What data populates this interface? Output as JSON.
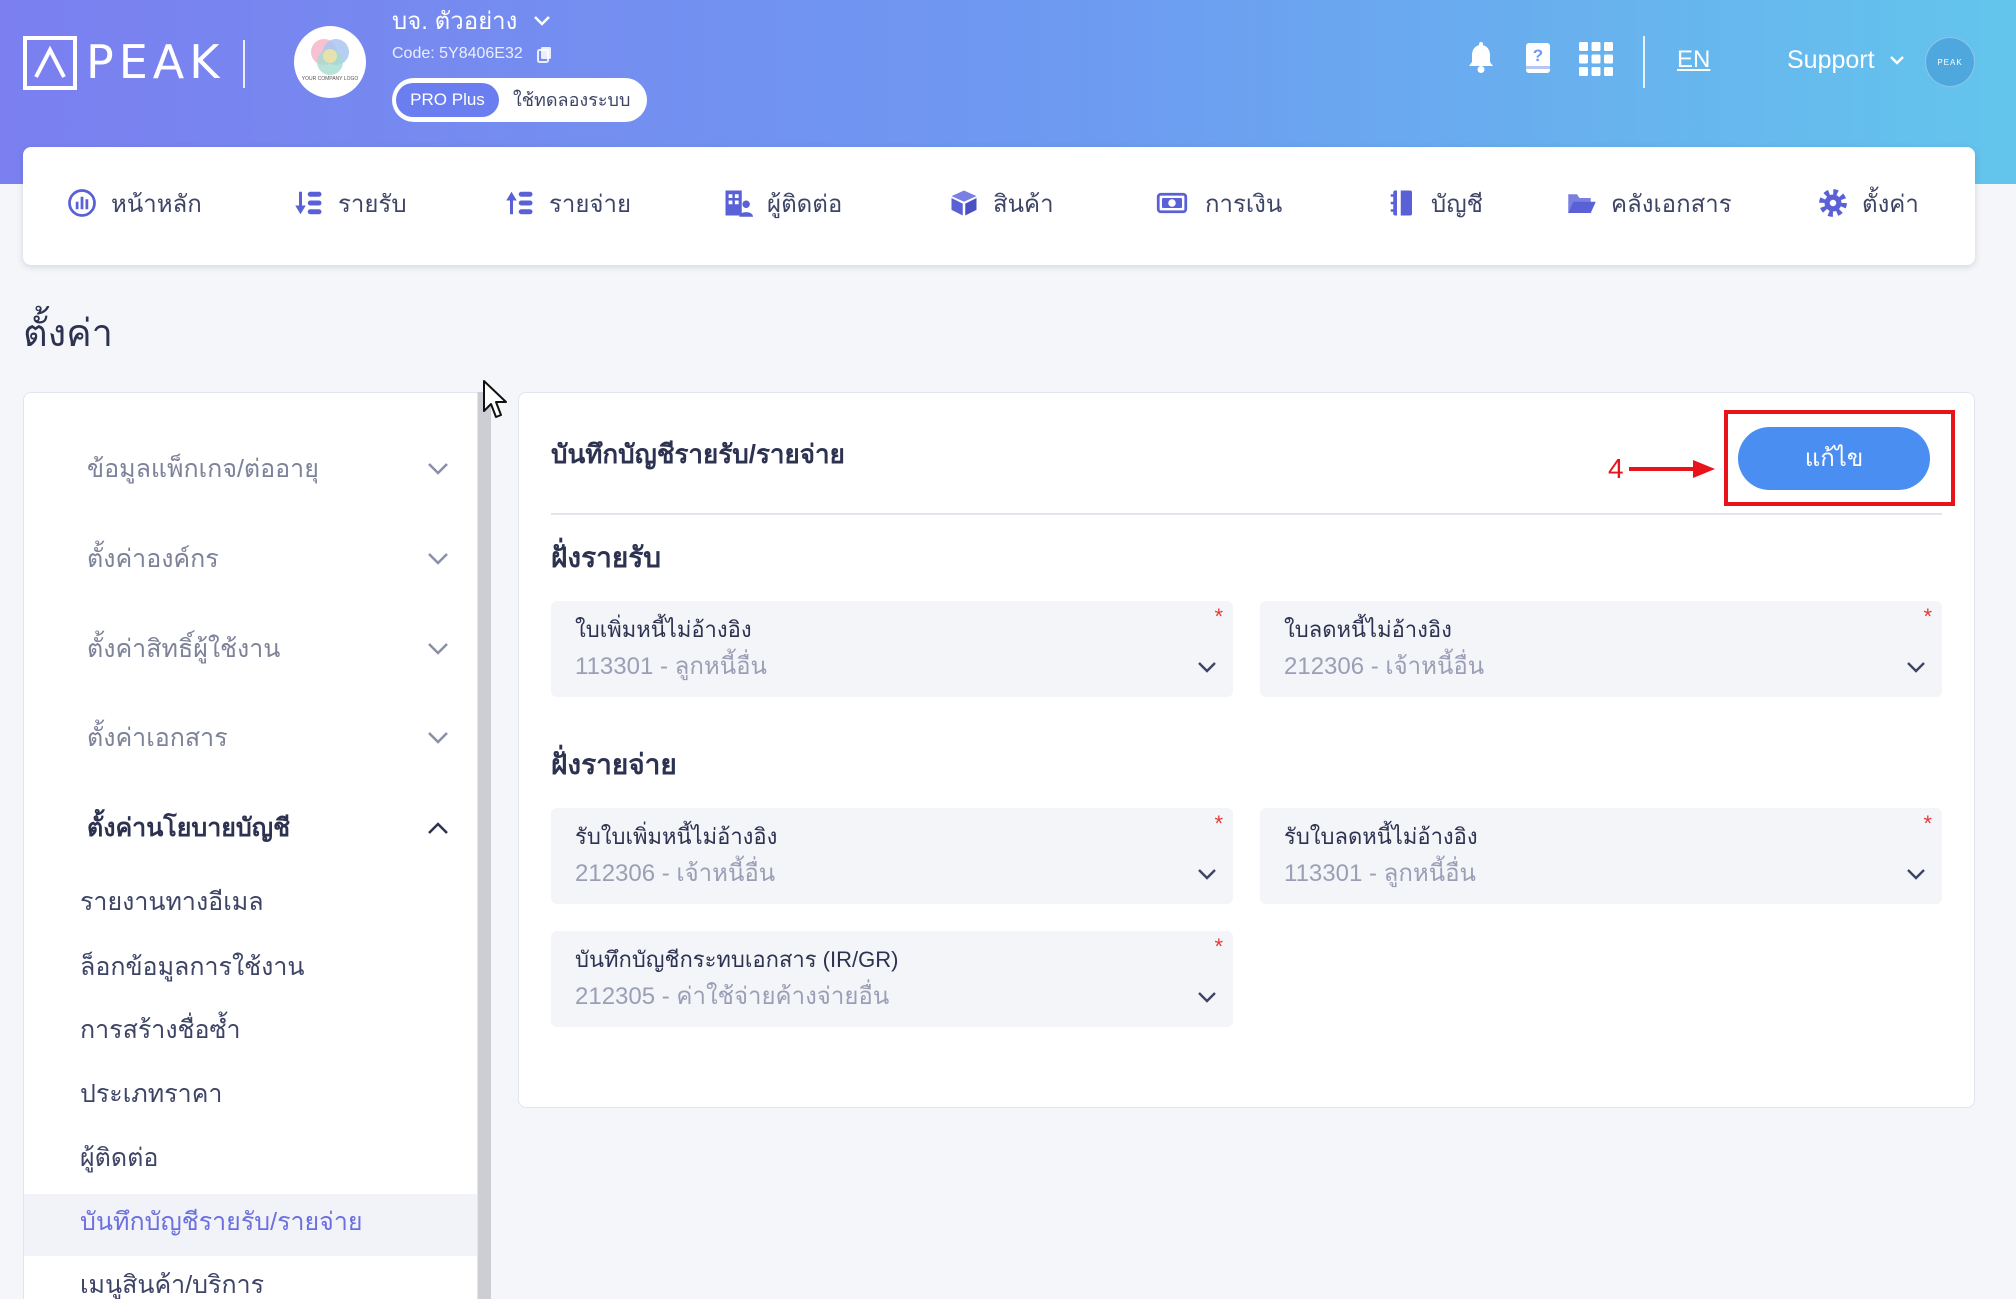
{
  "header": {
    "logo_text": "PEAK",
    "company_logo_text": "YOUR COMPANY LOGO",
    "company_name": "บจ. ตัวอย่าง",
    "company_code": "Code: 5Y8406E32",
    "plan_badge": "PRO Plus",
    "trial_label": "ใช้ทดลองระบบ",
    "language_link": "EN",
    "support_label": "Support",
    "avatar_text": "PEAK",
    "icons": {
      "notifications": "bell-icon",
      "help": "help-book-icon",
      "apps": "apps-grid-icon",
      "copy": "copy-icon",
      "company_menu": "chevron-down-icon",
      "support_menu": "chevron-down-icon"
    }
  },
  "nav": {
    "items": [
      {
        "label": "หน้าหลัก",
        "icon": "dashboard-icon"
      },
      {
        "label": "รายรับ",
        "icon": "income-icon"
      },
      {
        "label": "รายจ่าย",
        "icon": "expense-icon"
      },
      {
        "label": "ผู้ติดต่อ",
        "icon": "contacts-icon"
      },
      {
        "label": "สินค้า",
        "icon": "product-box-icon"
      },
      {
        "label": "การเงิน",
        "icon": "money-icon"
      },
      {
        "label": "บัญชี",
        "icon": "ledger-book-icon"
      },
      {
        "label": "คลังเอกสาร",
        "icon": "folder-icon"
      },
      {
        "label": "ตั้งค่า",
        "icon": "gear-icon"
      }
    ]
  },
  "page_title": "ตั้งค่า",
  "sidebar": {
    "groups": [
      {
        "label": "ข้อมูลแพ็กเกจ/ต่ออายุ",
        "expanded": false
      },
      {
        "label": "ตั้งค่าองค์กร",
        "expanded": false
      },
      {
        "label": "ตั้งค่าสิทธิ์ผู้ใช้งาน",
        "expanded": false
      },
      {
        "label": "ตั้งค่าเอกสาร",
        "expanded": false
      },
      {
        "label": "ตั้งค่านโยบายบัญชี",
        "expanded": true
      }
    ],
    "subitems": [
      {
        "label": "รายงานทางอีเมล",
        "active": false
      },
      {
        "label": "ล็อกข้อมูลการใช้งาน",
        "active": false
      },
      {
        "label": "การสร้างชื่อซ้ำ",
        "active": false
      },
      {
        "label": "ประเภทราคา",
        "active": false
      },
      {
        "label": "ผู้ติดต่อ",
        "active": false
      },
      {
        "label": "บันทึกบัญชีรายรับ/รายจ่าย",
        "active": true
      },
      {
        "label": "เมนูสินค้า/บริการ",
        "active": false
      }
    ]
  },
  "panel": {
    "title": "บันทึกบัญชีรายรับ/รายจ่าย",
    "edit_button": "แก้ไข",
    "annotation_step": "4",
    "required_mark": "*",
    "sections": [
      {
        "heading": "ฝั่งรายรับ",
        "fields": [
          {
            "label": "ใบเพิ่มหนี้ไม่อ้างอิง",
            "value": "113301 - ลูกหนี้อื่น",
            "required": true
          },
          {
            "label": "ใบลดหนี้ไม่อ้างอิง",
            "value": "212306 - เจ้าหนี้อื่น",
            "required": true
          }
        ]
      },
      {
        "heading": "ฝั่งรายจ่าย",
        "fields": [
          {
            "label": "รับใบเพิ่มหนี้ไม่อ้างอิง",
            "value": "212306 - เจ้าหนี้อื่น",
            "required": true
          },
          {
            "label": "รับใบลดหนี้ไม่อ้างอิง",
            "value": "113301 - ลูกหนี้อื่น",
            "required": true
          },
          {
            "label": "บันทึกบัญชีกระทบเอกสาร (IR/GR)",
            "value": "212305 - ค่าใช้จ่ายค้างจ่ายอื่น",
            "required": true
          }
        ]
      }
    ]
  },
  "colors": {
    "accent": "#4b8ef1",
    "brand": "#5a61d6",
    "annotation": "#e8141a",
    "active_item": "#6b6fe0"
  }
}
